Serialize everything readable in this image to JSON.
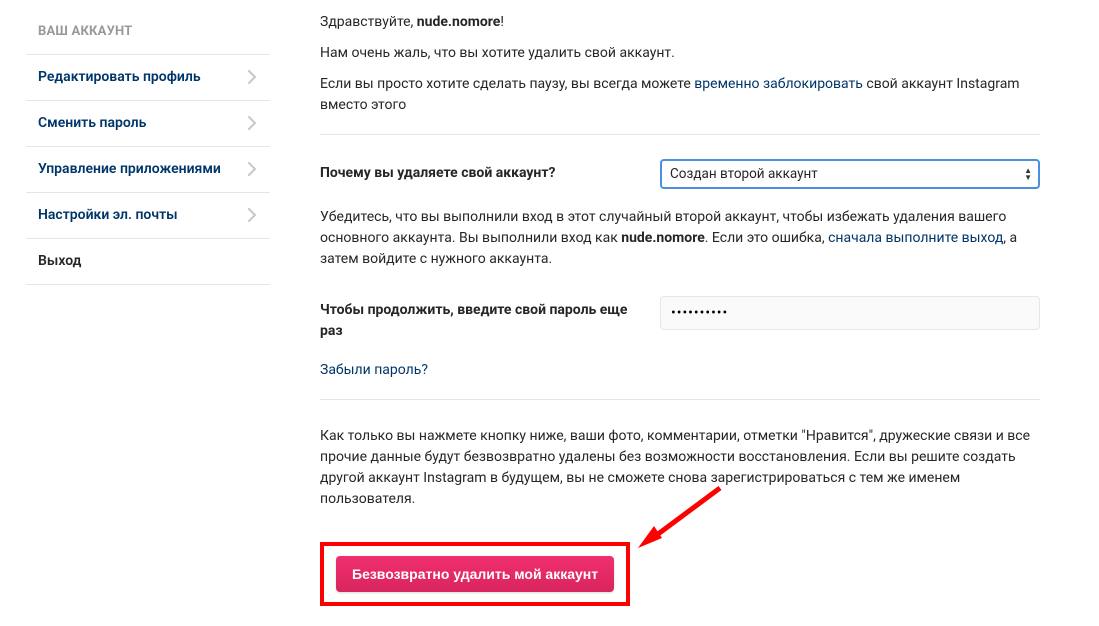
{
  "sidebar": {
    "title": "ВАШ АККАУНТ",
    "items": [
      {
        "label": "Редактировать профиль",
        "chevron": true
      },
      {
        "label": "Сменить пароль",
        "chevron": true
      },
      {
        "label": "Управление приложениями",
        "chevron": true
      },
      {
        "label": "Настройки эл. почты",
        "chevron": true
      },
      {
        "label": "Выход",
        "chevron": false,
        "logout": true
      }
    ]
  },
  "main": {
    "greeting_prefix": "Здравствуйте, ",
    "username": "nude.nomore",
    "greeting_suffix": "!",
    "sorry_line": "Нам очень жаль, что вы хотите удалить свой аккаунт.",
    "pause_prefix": "Если вы просто хотите сделать паузу, вы всегда можете ",
    "pause_link": "временно заблокировать",
    "pause_suffix": " свой аккаунт Instagram вместо этого",
    "reason_label": "Почему вы удаляете свой аккаунт?",
    "reason_selected": "Создан второй аккаунт",
    "hint_prefix": "Убедитесь, что вы выполнили вход в этот случайный второй аккаунт, чтобы избежать удаления вашего основного аккаунта. Вы выполнили вход как ",
    "hint_username": "nude.nomore",
    "hint_mid": ". Если это ошибка, ",
    "hint_link": "сначала выполните выход",
    "hint_suffix": ", а затем войдите с нужного аккаунта.",
    "password_label": "Чтобы продолжить, введите свой пароль еще раз",
    "password_value": "••••••••••",
    "forgot_link": "Забыли пароль?",
    "warning_text": "Как только вы нажмете кнопку ниже, ваши фото, комментарии, отметки \"Нравится\", дружеские связи и все прочие данные будут безвозвратно удалены без возможности восстановления. Если вы решите создать другой аккаунт Instagram в будущем, вы не сможете снова зарегистрироваться с тем же именем пользователя.",
    "delete_button": "Безвозвратно удалить мой аккаунт"
  }
}
